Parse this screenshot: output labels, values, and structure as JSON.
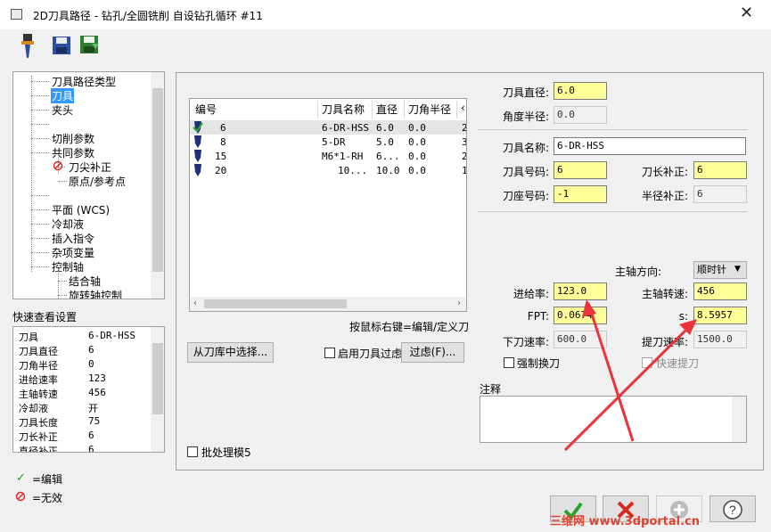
{
  "window": {
    "title": "2D刀具路径 - 钻孔/全圆铣削 自设钻孔循环 #11",
    "close_glyph": "✕"
  },
  "toolbar": {
    "icons": [
      "drill-tool-icon",
      "save-icon",
      "save-export-icon"
    ]
  },
  "tree": {
    "items": [
      {
        "label": "刀具路径类型"
      },
      {
        "label": "刀具",
        "selected": true
      },
      {
        "label": "夹头"
      },
      {
        "label": "切削参数"
      },
      {
        "label": "共同参数"
      },
      {
        "label": "刀尖补正"
      },
      {
        "label": "原点/参考点"
      },
      {
        "label": "平面 (WCS)"
      },
      {
        "label": "冷却液"
      },
      {
        "label": "插入指令"
      },
      {
        "label": "杂项变量"
      },
      {
        "label": "控制轴"
      },
      {
        "label": "结合轴"
      },
      {
        "label": "旋转轴控制"
      }
    ]
  },
  "quick_view": {
    "title": "快速查看设置",
    "rows": [
      {
        "key": "刀具",
        "value": "6-DR-HSS"
      },
      {
        "key": "刀具直径",
        "value": "6"
      },
      {
        "key": "刀角半径",
        "value": "0"
      },
      {
        "key": "进给速率",
        "value": "123"
      },
      {
        "key": "主轴转速",
        "value": "456"
      },
      {
        "key": "冷却液",
        "value": "开"
      },
      {
        "key": "刀具长度",
        "value": "75"
      },
      {
        "key": "刀长补正",
        "value": "6"
      },
      {
        "key": "直径补正",
        "value": "6"
      }
    ]
  },
  "legend": {
    "edit": "=编辑",
    "invalid": "=无效"
  },
  "tool_table": {
    "headers": [
      "编号",
      "刀具名称",
      "直径",
      "刀角半径",
      "‹"
    ],
    "rows": [
      {
        "num": "6",
        "name": "6-DR-HSS",
        "dia": "6.0",
        "radius": "0.0",
        "extra": "2"
      },
      {
        "num": "8",
        "name": "5-DR",
        "dia": "5.0",
        "radius": "0.0",
        "extra": "3"
      },
      {
        "num": "15",
        "name": "M6*1-RH",
        "dia": "6...",
        "radius": "0.0",
        "extra": "2"
      },
      {
        "num": "20",
        "name": "10...",
        "dia": "10.0",
        "radius": "0.0",
        "extra": "1"
      }
    ]
  },
  "hint": "按鼠标右键=编辑/定义刀",
  "buttons": {
    "select_library": "从刀库中选择...",
    "enable_filter": "启用刀具过虑",
    "filter": "过虑(F)...",
    "batch": "批处理模5"
  },
  "params": {
    "tool_diameter_label": "刀具直径:",
    "tool_diameter": "6.0",
    "corner_radius_label": "角度半径:",
    "corner_radius": "0.0",
    "tool_name_label": "刀具名称:",
    "tool_name": "6-DR-HSS",
    "tool_number_label": "刀具号码:",
    "tool_number": "6",
    "length_offset_label": "刀长补正:",
    "length_offset": "6",
    "holder_number_label": "刀座号码:",
    "holder_number": "-1",
    "dia_offset_label": "半径补正:",
    "dia_offset": "6",
    "spindle_dir_label": "主轴方向:",
    "spindle_dir": "顺时针",
    "feed_rate_label": "进给率:",
    "feed_rate": "123.0",
    "spindle_speed_label": "主轴转速:",
    "spindle_speed": "456",
    "fpt_label": "FPT:",
    "fpt": "0.0674",
    "sfm_label": "s:",
    "sfm": "8.5957",
    "plunge_label": "下刀速率:",
    "plunge": "600.0",
    "retract_label": "提刀速率:",
    "retract": "1500.0",
    "force_change": "强制换刀",
    "rapid_retract": "快速提刀",
    "comment_label": "注释"
  },
  "watermark": "三维网 www.3dportal.cn",
  "colors": {
    "highlight_field": "#ffff99",
    "arrow": "#e8343a"
  }
}
